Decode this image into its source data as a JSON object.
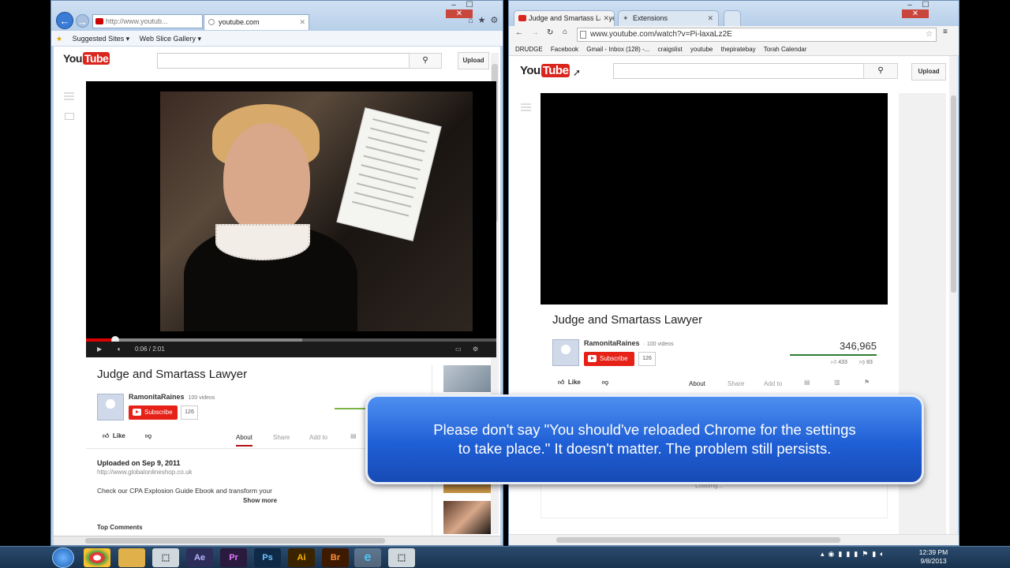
{
  "ie": {
    "address": "http://www.youtub...",
    "tab_title": "youtube.com",
    "favorites_bar": [
      "Suggested Sites ▾",
      "Web Slice Gallery ▾"
    ],
    "header": {
      "upload": "Upload"
    },
    "player": {
      "time": "0:06 / 2:01",
      "progress_fraction": 0.05
    },
    "video": {
      "title": "Judge and Smartass Lawyer",
      "channel": "RamonitaRaines",
      "videos_count": "100 videos",
      "subscribe": "Subscribe",
      "subscriber_count": "126",
      "like": "Like",
      "tabs": [
        "About",
        "Share",
        "Add to"
      ],
      "uploaded": "Uploaded on Sep 9, 2011",
      "url_line": "http://www.globalonlineshop.co.uk",
      "description": "Check our CPA Explosion Guide Ebook and transform your",
      "show_more": "Show more",
      "top_comments": "Top Comments"
    }
  },
  "chrome": {
    "tabs": [
      {
        "label": "Judge and Smartass Lawye"
      },
      {
        "label": "Extensions"
      }
    ],
    "url": "www.youtube.com/watch?v=Pi-laxaLz2E",
    "bookmarks": [
      "DRUDGE",
      "Facebook",
      "Gmail - Inbox (128) -...",
      "craigslist",
      "youtube",
      "thepiratebay",
      "Torah Calendar"
    ],
    "header": {
      "upload": "Upload"
    },
    "video": {
      "title": "Judge and Smartass Lawyer",
      "channel": "RamonitaRaines",
      "videos_count": "· 100 videos",
      "subscribe": "Subscribe",
      "subscriber_count": "126",
      "views": "346,965",
      "likes": "433",
      "dislikes": "83",
      "like": "Like",
      "tabs": [
        "About",
        "Share",
        "Add to"
      ],
      "loading": "Loading..."
    }
  },
  "callout": {
    "line1": "Please don't say \"You should've reloaded  Chrome for the settings",
    "line2": "to take place.\" It doesn't matter. The problem still persists."
  },
  "taskbar": {
    "apps": [
      "Ae",
      "Pr",
      "Ps",
      "Ai",
      "Br"
    ],
    "clock_time": "12:39 PM",
    "clock_date": "9/8/2013"
  },
  "colors": {
    "yt_red": "#e62117",
    "callout_blue": "#2f6fe0"
  }
}
